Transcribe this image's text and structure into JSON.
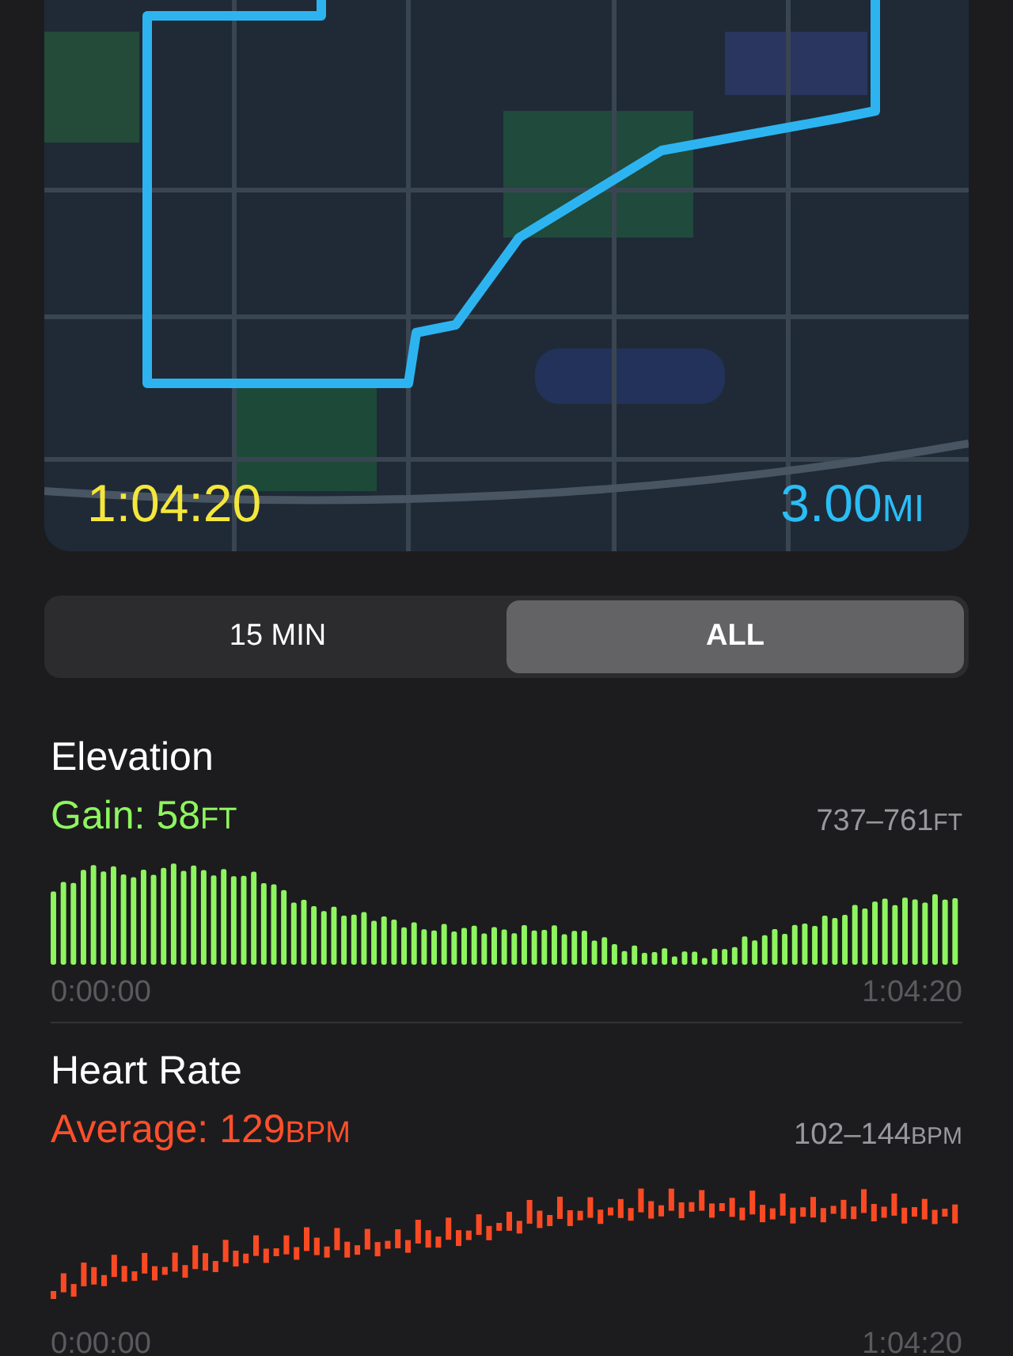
{
  "map": {
    "duration": "1:04:20",
    "distance": {
      "value": "3.00",
      "unit": "MI"
    }
  },
  "segments": [
    {
      "label": "15 MIN",
      "selected": false
    },
    {
      "label": "ALL",
      "selected": true
    }
  ],
  "metrics": [
    {
      "kind": "elevation",
      "title": "Elevation",
      "summary": {
        "label": "Gain: ",
        "value": "58",
        "unit": "FT"
      },
      "range": {
        "value": "737–761",
        "unit": "FT"
      },
      "start": "0:00:00",
      "end": "1:04:20"
    },
    {
      "kind": "heart",
      "title": "Heart Rate",
      "summary": {
        "label": "Average: ",
        "value": "129",
        "unit": "BPM"
      },
      "range": {
        "value": "102–144",
        "unit": "BPM"
      },
      "start": "0:00:00",
      "end": "1:04:20"
    }
  ]
}
